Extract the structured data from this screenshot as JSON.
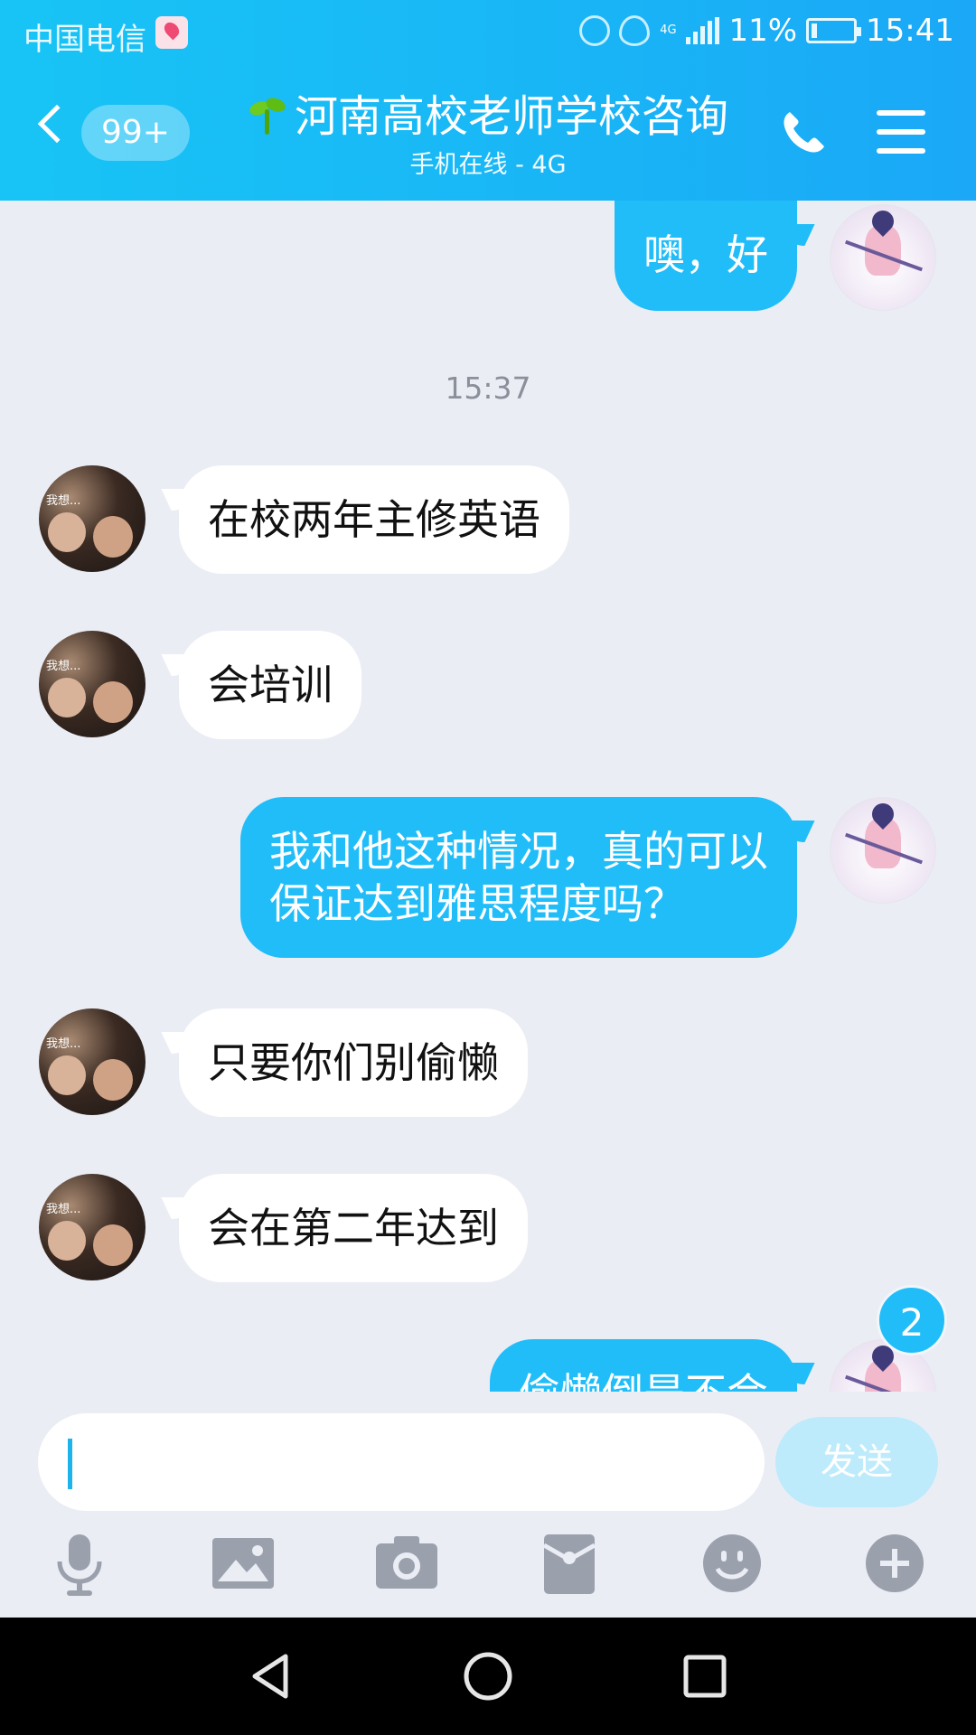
{
  "status_bar": {
    "carrier": "中国电信",
    "network": "4G",
    "battery": "11%",
    "time": "15:41"
  },
  "header": {
    "unread_count": "99+",
    "title": "河南高校老师学校咨询",
    "subtitle": "手机在线 - 4G",
    "icons": [
      "back-icon",
      "sprout-icon",
      "phone-icon",
      "menu-icon"
    ],
    "bg_color": "#19b6f6"
  },
  "chat": {
    "timestamp": "15:37",
    "messages": [
      {
        "from": "self",
        "text": "噢，好"
      },
      {
        "from": "other",
        "text": "在校两年主修英语"
      },
      {
        "from": "other",
        "text": "会培训"
      },
      {
        "from": "self",
        "text_line1": "我和他这种情况，真的可以",
        "text_line2": "保证达到雅思程度吗？"
      },
      {
        "from": "other",
        "text": "只要你们别偷懒"
      },
      {
        "from": "other",
        "text": "会在第二年达到"
      },
      {
        "from": "self",
        "text": "偷懒倒是不会"
      }
    ],
    "other_avatar_text": "我想...",
    "new_message_badge": "2",
    "self_bubble_color": "#21bdf9"
  },
  "input_bar": {
    "input_value": "",
    "send_label": "发送",
    "tools": [
      "microphone-icon",
      "image-icon",
      "camera-icon",
      "red-packet-icon",
      "emoji-icon",
      "plus-icon"
    ]
  },
  "nav_bar": {
    "buttons": [
      "back-triangle-icon",
      "home-circle-icon",
      "recents-square-icon"
    ]
  }
}
